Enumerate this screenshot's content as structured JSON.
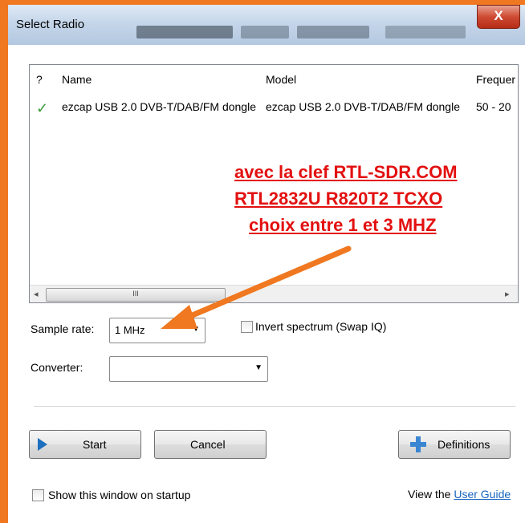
{
  "window": {
    "title": "Select Radio",
    "close_label": "X"
  },
  "list": {
    "columns": [
      "?",
      "Name",
      "Model",
      "Frequer"
    ],
    "rows": [
      {
        "status": "✓",
        "name": "ezcap USB 2.0 DVB-T/DAB/FM dongle",
        "model": "ezcap USB 2.0 DVB-T/DAB/FM dongle",
        "frequency": "50 - 20"
      }
    ],
    "scroll_left": "◂",
    "scroll_right": "▸",
    "scroll_thumb": "III"
  },
  "annotation": {
    "line1": "avec la clef RTL-SDR.COM",
    "line2": "RTL2832U R820T2 TCXO",
    "line3": "choix entre 1 et 3 MHZ"
  },
  "settings": {
    "sample_rate_label": "Sample rate:",
    "sample_rate_value": "1 MHz",
    "converter_label": "Converter:",
    "converter_value": "",
    "invert_spectrum_label": "Invert spectrum (Swap IQ)",
    "invert_spectrum_checked": false
  },
  "buttons": {
    "start": "Start",
    "cancel": "Cancel",
    "definitions": "Definitions"
  },
  "footer": {
    "show_on_startup_label": "Show this window on startup",
    "show_on_startup_checked": false,
    "view_the": "View the",
    "user_guide": "User Guide"
  },
  "colors": {
    "annotation": "#e31010",
    "arrow": "#f07820",
    "accent": "#1f6fbf"
  }
}
